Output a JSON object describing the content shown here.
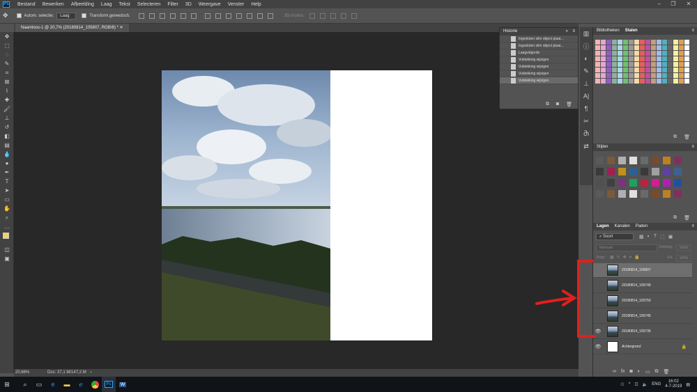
{
  "app": {
    "logo": "Ps"
  },
  "menu": [
    "Bestand",
    "Bewerken",
    "Afbeelding",
    "Laag",
    "Tekst",
    "Selecteren",
    "Filter",
    "3D",
    "Weergave",
    "Venster",
    "Help"
  ],
  "options": {
    "auto_select_label": "Autom. selectie:",
    "layer_select": "Laag",
    "transform_label": "Transform.gereedsch.",
    "mode_3d": "3D-modus:"
  },
  "document": {
    "tab_title": "Naamloos-1 @ 20,7% (20180814_105807, RGB/8) *"
  },
  "status": {
    "zoom": "20,66%",
    "doc_info": "Doc: 37,1 M/147,2 M"
  },
  "history": {
    "title": "Historie",
    "items": [
      "Ingesloten slim object plaat...",
      "Ingesloten slim object plaat...",
      "Laagvolgorde",
      "Vuldekking wijzigen",
      "Vuldekking wijzigen",
      "Vuldekking wijzigen",
      "Vuldekking wijzigen"
    ]
  },
  "top_panel": {
    "tabs": [
      "Bibliotheken",
      "Stalen"
    ]
  },
  "styles_panel": {
    "title": "Stijlen"
  },
  "layers_panel": {
    "tabs": [
      "Lagen",
      "Kanalen",
      "Paden"
    ],
    "search": "Soort",
    "blend": "Normaal",
    "opacity_label": "Dekking:",
    "opacity_value": "100%",
    "lock_label": "Vergr.:",
    "fill_label": "Vul:",
    "fill_value": "100%",
    "layers": [
      {
        "name": "20180814_105807",
        "visible": false,
        "selected": true
      },
      {
        "name": "20180814_105749",
        "visible": false,
        "selected": false
      },
      {
        "name": "20180814_105750",
        "visible": false,
        "selected": false
      },
      {
        "name": "20180814_105745",
        "visible": false,
        "selected": false
      },
      {
        "name": "20180814_105736",
        "visible": true,
        "selected": false
      },
      {
        "name": "Achtergrond",
        "visible": true,
        "selected": false,
        "background": true
      }
    ]
  },
  "annotation": {
    "color": "#e0201c"
  },
  "taskbar": {
    "time": "16:02",
    "date": "4-7-2019",
    "lang": "ENG"
  }
}
